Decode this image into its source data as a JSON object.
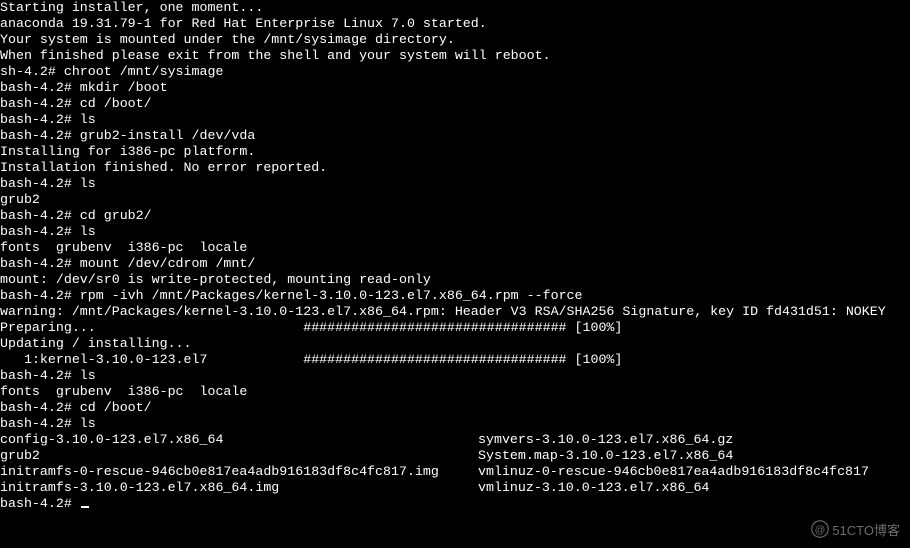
{
  "intro": [
    "Starting installer, one moment...",
    "anaconda 19.31.79-1 for Red Hat Enterprise Linux 7.0 started.",
    "",
    "Your system is mounted under the /mnt/sysimage directory.",
    "When finished please exit from the shell and your system will reboot.",
    ""
  ],
  "session": [
    {
      "prompt": "sh-4.2# ",
      "cmd": "chroot /mnt/sysimage"
    },
    {
      "prompt": "bash-4.2# ",
      "cmd": "mkdir /boot"
    },
    {
      "prompt": "bash-4.2# ",
      "cmd": "cd /boot/"
    },
    {
      "prompt": "bash-4.2# ",
      "cmd": "ls"
    },
    {
      "prompt": "bash-4.2# ",
      "cmd": "grub2-install /dev/vda"
    },
    {
      "out": "Installing for i386-pc platform."
    },
    {
      "out": "Installation finished. No error reported."
    },
    {
      "prompt": "bash-4.2# ",
      "cmd": "ls"
    },
    {
      "out": "grub2"
    },
    {
      "prompt": "bash-4.2# ",
      "cmd": "cd grub2/"
    },
    {
      "prompt": "bash-4.2# ",
      "cmd": "ls"
    },
    {
      "out": "fonts  grubenv  i386-pc  locale"
    },
    {
      "prompt": "bash-4.2# ",
      "cmd": "mount /dev/cdrom /mnt/"
    },
    {
      "out": "mount: /dev/sr0 is write-protected, mounting read-only"
    },
    {
      "prompt": "bash-4.2# ",
      "cmd": "rpm -ivh /mnt/Packages/kernel-3.10.0-123.el7.x86_64.rpm --force"
    },
    {
      "out": "warning: /mnt/Packages/kernel-3.10.0-123.el7.x86_64.rpm: Header V3 RSA/SHA256 Signature, key ID fd431d51: NOKEY"
    },
    {
      "out": "Preparing...                          ################################# [100%]"
    },
    {
      "out": "Updating / installing..."
    },
    {
      "out": "   1:kernel-3.10.0-123.el7            ################################# [100%]"
    },
    {
      "prompt": "bash-4.2# ",
      "cmd": "ls"
    },
    {
      "out": "fonts  grubenv  i386-pc  locale"
    },
    {
      "prompt": "bash-4.2# ",
      "cmd": "cd /boot/"
    },
    {
      "prompt": "bash-4.2# ",
      "cmd": "ls"
    }
  ],
  "listing": [
    {
      "c1": "config-3.10.0-123.el7.x86_64",
      "c2": "symvers-3.10.0-123.el7.x86_64.gz"
    },
    {
      "c1": "grub2",
      "c2": "System.map-3.10.0-123.el7.x86_64"
    },
    {
      "c1": "initramfs-0-rescue-946cb0e817ea4adb916183df8c4fc817.img",
      "c2": "vmlinuz-0-rescue-946cb0e817ea4adb916183df8c4fc817"
    },
    {
      "c1": "initramfs-3.10.0-123.el7.x86_64.img",
      "c2": "vmlinuz-3.10.0-123.el7.x86_64"
    }
  ],
  "final_prompt": "bash-4.2# ",
  "watermark": "51CTO博客"
}
